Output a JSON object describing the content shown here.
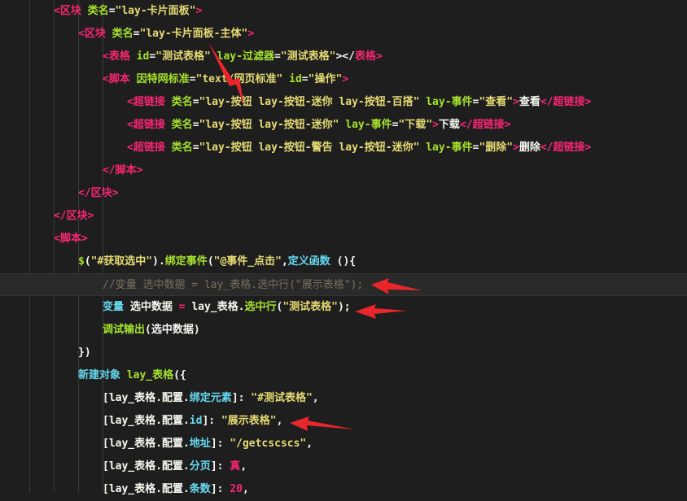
{
  "code": {
    "lines": [
      {
        "indent": 2,
        "segments": [
          {
            "c": "tag",
            "t": "<"
          },
          {
            "c": "tag",
            "t": "区块"
          },
          {
            "c": "plain",
            "t": " "
          },
          {
            "c": "attr",
            "t": "类名"
          },
          {
            "c": "punc",
            "t": "="
          },
          {
            "c": "str",
            "t": "\"lay-卡片面板\""
          },
          {
            "c": "tag",
            "t": ">"
          }
        ]
      },
      {
        "indent": 3,
        "segments": [
          {
            "c": "tag",
            "t": "<"
          },
          {
            "c": "tag",
            "t": "区块"
          },
          {
            "c": "plain",
            "t": " "
          },
          {
            "c": "attr",
            "t": "类名"
          },
          {
            "c": "punc",
            "t": "="
          },
          {
            "c": "str",
            "t": "\"lay-卡片面板-主体\""
          },
          {
            "c": "tag",
            "t": ">"
          }
        ]
      },
      {
        "indent": 4,
        "segments": [
          {
            "c": "tag",
            "t": "<"
          },
          {
            "c": "tag",
            "t": "表格"
          },
          {
            "c": "plain",
            "t": " "
          },
          {
            "c": "attr",
            "t": "id"
          },
          {
            "c": "punc",
            "t": "="
          },
          {
            "c": "str",
            "t": "\"测试表格\""
          },
          {
            "c": "plain",
            "t": " "
          },
          {
            "c": "attr",
            "t": "lay-过滤器"
          },
          {
            "c": "punc",
            "t": "="
          },
          {
            "c": "str",
            "t": "\"测试表格\""
          },
          {
            "c": "punc",
            "t": "></"
          },
          {
            "c": "tag",
            "t": "表格"
          },
          {
            "c": "tag",
            "t": ">"
          }
        ]
      },
      {
        "indent": 4,
        "segments": [
          {
            "c": "tag",
            "t": "<"
          },
          {
            "c": "tag",
            "t": "脚本"
          },
          {
            "c": "plain",
            "t": " "
          },
          {
            "c": "attr",
            "t": "因特网标准"
          },
          {
            "c": "punc",
            "t": "="
          },
          {
            "c": "str",
            "t": "\"text/网页标准\""
          },
          {
            "c": "plain",
            "t": " "
          },
          {
            "c": "attr",
            "t": "id"
          },
          {
            "c": "punc",
            "t": "="
          },
          {
            "c": "str",
            "t": "\"操作\""
          },
          {
            "c": "tag",
            "t": ">"
          }
        ]
      },
      {
        "indent": 5,
        "segments": [
          {
            "c": "tag",
            "t": "<"
          },
          {
            "c": "tag",
            "t": "超链接"
          },
          {
            "c": "plain",
            "t": " "
          },
          {
            "c": "attr",
            "t": "类名"
          },
          {
            "c": "punc",
            "t": "="
          },
          {
            "c": "str",
            "t": "\"lay-按钮 lay-按钮-迷你 lay-按钮-百搭\""
          },
          {
            "c": "plain",
            "t": " "
          },
          {
            "c": "attr",
            "t": "lay-事件"
          },
          {
            "c": "punc",
            "t": "="
          },
          {
            "c": "str",
            "t": "\"查看\""
          },
          {
            "c": "tag",
            "t": ">"
          },
          {
            "c": "plain",
            "t": "查看"
          },
          {
            "c": "tag",
            "t": "</"
          },
          {
            "c": "tag",
            "t": "超链接"
          },
          {
            "c": "tag",
            "t": ">"
          }
        ]
      },
      {
        "indent": 5,
        "segments": [
          {
            "c": "tag",
            "t": "<"
          },
          {
            "c": "tag",
            "t": "超链接"
          },
          {
            "c": "plain",
            "t": " "
          },
          {
            "c": "attr",
            "t": "类名"
          },
          {
            "c": "punc",
            "t": "="
          },
          {
            "c": "str",
            "t": "\"lay-按钮 lay-按钮-迷你\""
          },
          {
            "c": "plain",
            "t": " "
          },
          {
            "c": "attr",
            "t": "lay-事件"
          },
          {
            "c": "punc",
            "t": "="
          },
          {
            "c": "str",
            "t": "\"下载\""
          },
          {
            "c": "tag",
            "t": ">"
          },
          {
            "c": "plain",
            "t": "下载"
          },
          {
            "c": "tag",
            "t": "</"
          },
          {
            "c": "tag",
            "t": "超链接"
          },
          {
            "c": "tag",
            "t": ">"
          }
        ]
      },
      {
        "indent": 5,
        "segments": [
          {
            "c": "tag",
            "t": "<"
          },
          {
            "c": "tag",
            "t": "超链接"
          },
          {
            "c": "plain",
            "t": " "
          },
          {
            "c": "attr",
            "t": "类名"
          },
          {
            "c": "punc",
            "t": "="
          },
          {
            "c": "str",
            "t": "\"lay-按钮 lay-按钮-警告 lay-按钮-迷你\""
          },
          {
            "c": "plain",
            "t": " "
          },
          {
            "c": "attr",
            "t": "lay-事件"
          },
          {
            "c": "punc",
            "t": "="
          },
          {
            "c": "str",
            "t": "\"删除\""
          },
          {
            "c": "tag",
            "t": ">"
          },
          {
            "c": "plain",
            "t": "删除"
          },
          {
            "c": "tag",
            "t": "</"
          },
          {
            "c": "tag",
            "t": "超链接"
          },
          {
            "c": "tag",
            "t": ">"
          }
        ]
      },
      {
        "indent": 4,
        "segments": [
          {
            "c": "tag",
            "t": "</"
          },
          {
            "c": "tag",
            "t": "脚本"
          },
          {
            "c": "tag",
            "t": ">"
          }
        ]
      },
      {
        "indent": 3,
        "segments": [
          {
            "c": "tag",
            "t": "</"
          },
          {
            "c": "tag",
            "t": "区块"
          },
          {
            "c": "tag",
            "t": ">"
          }
        ]
      },
      {
        "indent": 2,
        "segments": [
          {
            "c": "tag",
            "t": "</"
          },
          {
            "c": "tag",
            "t": "区块"
          },
          {
            "c": "tag",
            "t": ">"
          }
        ]
      },
      {
        "indent": 2,
        "segments": [
          {
            "c": "tag",
            "t": "<"
          },
          {
            "c": "tag",
            "t": "脚本"
          },
          {
            "c": "tag",
            "t": ">"
          }
        ]
      },
      {
        "indent": 3,
        "segments": [
          {
            "c": "fn",
            "t": "$"
          },
          {
            "c": "punc",
            "t": "("
          },
          {
            "c": "str",
            "t": "\"#获取选中\""
          },
          {
            "c": "punc",
            "t": ")."
          },
          {
            "c": "fn",
            "t": "绑定事件"
          },
          {
            "c": "punc",
            "t": "("
          },
          {
            "c": "str",
            "t": "\"@事件_点击\""
          },
          {
            "c": "punc",
            "t": ","
          },
          {
            "c": "kw",
            "t": "定义函数"
          },
          {
            "c": "plain",
            "t": " "
          },
          {
            "c": "punc",
            "t": "(){"
          }
        ]
      },
      {
        "indent": 4,
        "current": true,
        "segments": [
          {
            "c": "cmt",
            "t": "//变量 选中数据 = lay_表格.选中行(\"展示表格\");"
          }
        ]
      },
      {
        "indent": 4,
        "segments": [
          {
            "c": "kw",
            "t": "变量"
          },
          {
            "c": "plain",
            "t": " 选中数据 "
          },
          {
            "c": "tag",
            "t": "="
          },
          {
            "c": "plain",
            "t": " lay_表格."
          },
          {
            "c": "fn",
            "t": "选中行"
          },
          {
            "c": "punc",
            "t": "("
          },
          {
            "c": "str",
            "t": "\"测试表格\""
          },
          {
            "c": "punc",
            "t": ");"
          }
        ]
      },
      {
        "indent": 4,
        "segments": [
          {
            "c": "fn",
            "t": "调试输出"
          },
          {
            "c": "punc",
            "t": "(选中数据)"
          }
        ]
      },
      {
        "indent": 3,
        "segments": [
          {
            "c": "punc",
            "t": "})"
          }
        ]
      },
      {
        "indent": 3,
        "segments": [
          {
            "c": "kw",
            "t": "新建对象"
          },
          {
            "c": "plain",
            "t": " "
          },
          {
            "c": "fn",
            "t": "lay_表格"
          },
          {
            "c": "punc",
            "t": "({"
          }
        ]
      },
      {
        "indent": 4,
        "segments": [
          {
            "c": "punc",
            "t": "["
          },
          {
            "c": "plain",
            "t": "lay_表格.配置."
          },
          {
            "c": "kw",
            "t": "绑定元素"
          },
          {
            "c": "punc",
            "t": "]: "
          },
          {
            "c": "str",
            "t": "\"#测试表格\""
          },
          {
            "c": "punc",
            "t": ","
          }
        ]
      },
      {
        "indent": 4,
        "segments": [
          {
            "c": "punc",
            "t": "["
          },
          {
            "c": "plain",
            "t": "lay_表格.配置."
          },
          {
            "c": "kw",
            "t": "id"
          },
          {
            "c": "punc",
            "t": "]: "
          },
          {
            "c": "str",
            "t": "\"展示表格\""
          },
          {
            "c": "punc",
            "t": ","
          }
        ]
      },
      {
        "indent": 4,
        "segments": [
          {
            "c": "punc",
            "t": "["
          },
          {
            "c": "plain",
            "t": "lay_表格.配置."
          },
          {
            "c": "kw",
            "t": "地址"
          },
          {
            "c": "punc",
            "t": "]: "
          },
          {
            "c": "str",
            "t": "\"/getcscscs\""
          },
          {
            "c": "punc",
            "t": ","
          }
        ]
      },
      {
        "indent": 4,
        "segments": [
          {
            "c": "punc",
            "t": "["
          },
          {
            "c": "plain",
            "t": "lay_表格.配置."
          },
          {
            "c": "kw",
            "t": "分页"
          },
          {
            "c": "punc",
            "t": "]: "
          },
          {
            "c": "tag",
            "t": "真"
          },
          {
            "c": "punc",
            "t": ","
          }
        ]
      },
      {
        "indent": 4,
        "segments": [
          {
            "c": "punc",
            "t": "["
          },
          {
            "c": "plain",
            "t": "lay_表格.配置."
          },
          {
            "c": "kw",
            "t": "条数"
          },
          {
            "c": "punc",
            "t": "]: "
          },
          {
            "c": "tag",
            "t": "20"
          },
          {
            "c": "punc",
            "t": ","
          }
        ]
      }
    ]
  },
  "annotations": {
    "arrow_color": "#e8262b",
    "arrows": [
      "arrow-to-table-id",
      "arrow-to-commented-line",
      "arrow-to-select-row-call",
      "arrow-to-config-id"
    ]
  }
}
